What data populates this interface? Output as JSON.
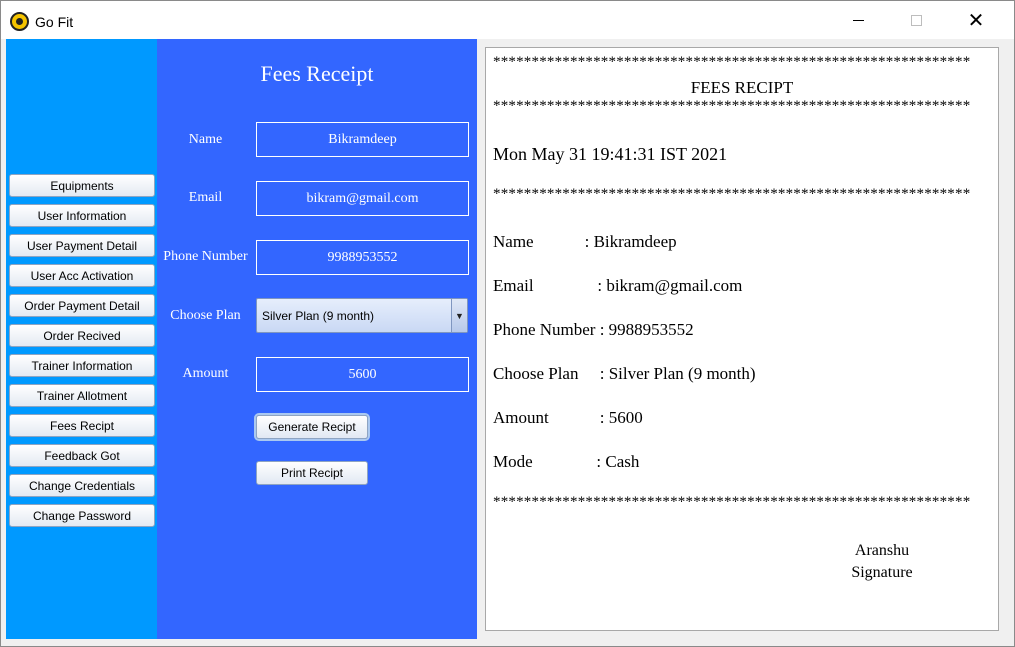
{
  "window": {
    "title": "Go Fit",
    "icons": {
      "app": "gym-logo-icon",
      "minimize": "minimize-icon",
      "maximize": "maximize-icon",
      "close": "close-icon"
    }
  },
  "sidebar": {
    "background": "#0099ff",
    "items": [
      {
        "label": "Equipments"
      },
      {
        "label": "User Information"
      },
      {
        "label": "User Payment Detail"
      },
      {
        "label": "User Acc Activation"
      },
      {
        "label": "Order Payment Detail"
      },
      {
        "label": "Order Recived"
      },
      {
        "label": "Trainer Information"
      },
      {
        "label": "Trainer Allotment"
      },
      {
        "label": "Fees Recipt"
      },
      {
        "label": "Feedback Got"
      },
      {
        "label": "Change Credentials"
      },
      {
        "label": "Change Password"
      }
    ]
  },
  "form": {
    "background": "#3366ff",
    "title": "Fees Receipt",
    "name": {
      "label": "Name",
      "value": "Bikramdeep"
    },
    "email": {
      "label": "Email",
      "value": "bikram@gmail.com"
    },
    "phone": {
      "label": "Phone Number",
      "value": "9988953552"
    },
    "plan": {
      "label": "Choose Plan",
      "value": "Silver Plan (9 month)"
    },
    "amount": {
      "label": "Amount",
      "value": "5600"
    },
    "generate_label": "Generate Recipt",
    "print_label": "Print Recipt"
  },
  "receipt": {
    "stars": "**************************************************************",
    "heading": "FEES RECIPT",
    "date": "Mon May 31 19:41:31 IST 2021",
    "rows": [
      {
        "text": "Name            : Bikramdeep"
      },
      {
        "text": "Email               : bikram@gmail.com"
      },
      {
        "text": "Phone Number : 9988953552"
      },
      {
        "text": "Choose Plan     : Silver Plan (9 month)"
      },
      {
        "text": "Amount            : 5600"
      },
      {
        "text": "Mode               : Cash"
      }
    ],
    "signer": "Aranshu",
    "signature_label": "Signature"
  }
}
